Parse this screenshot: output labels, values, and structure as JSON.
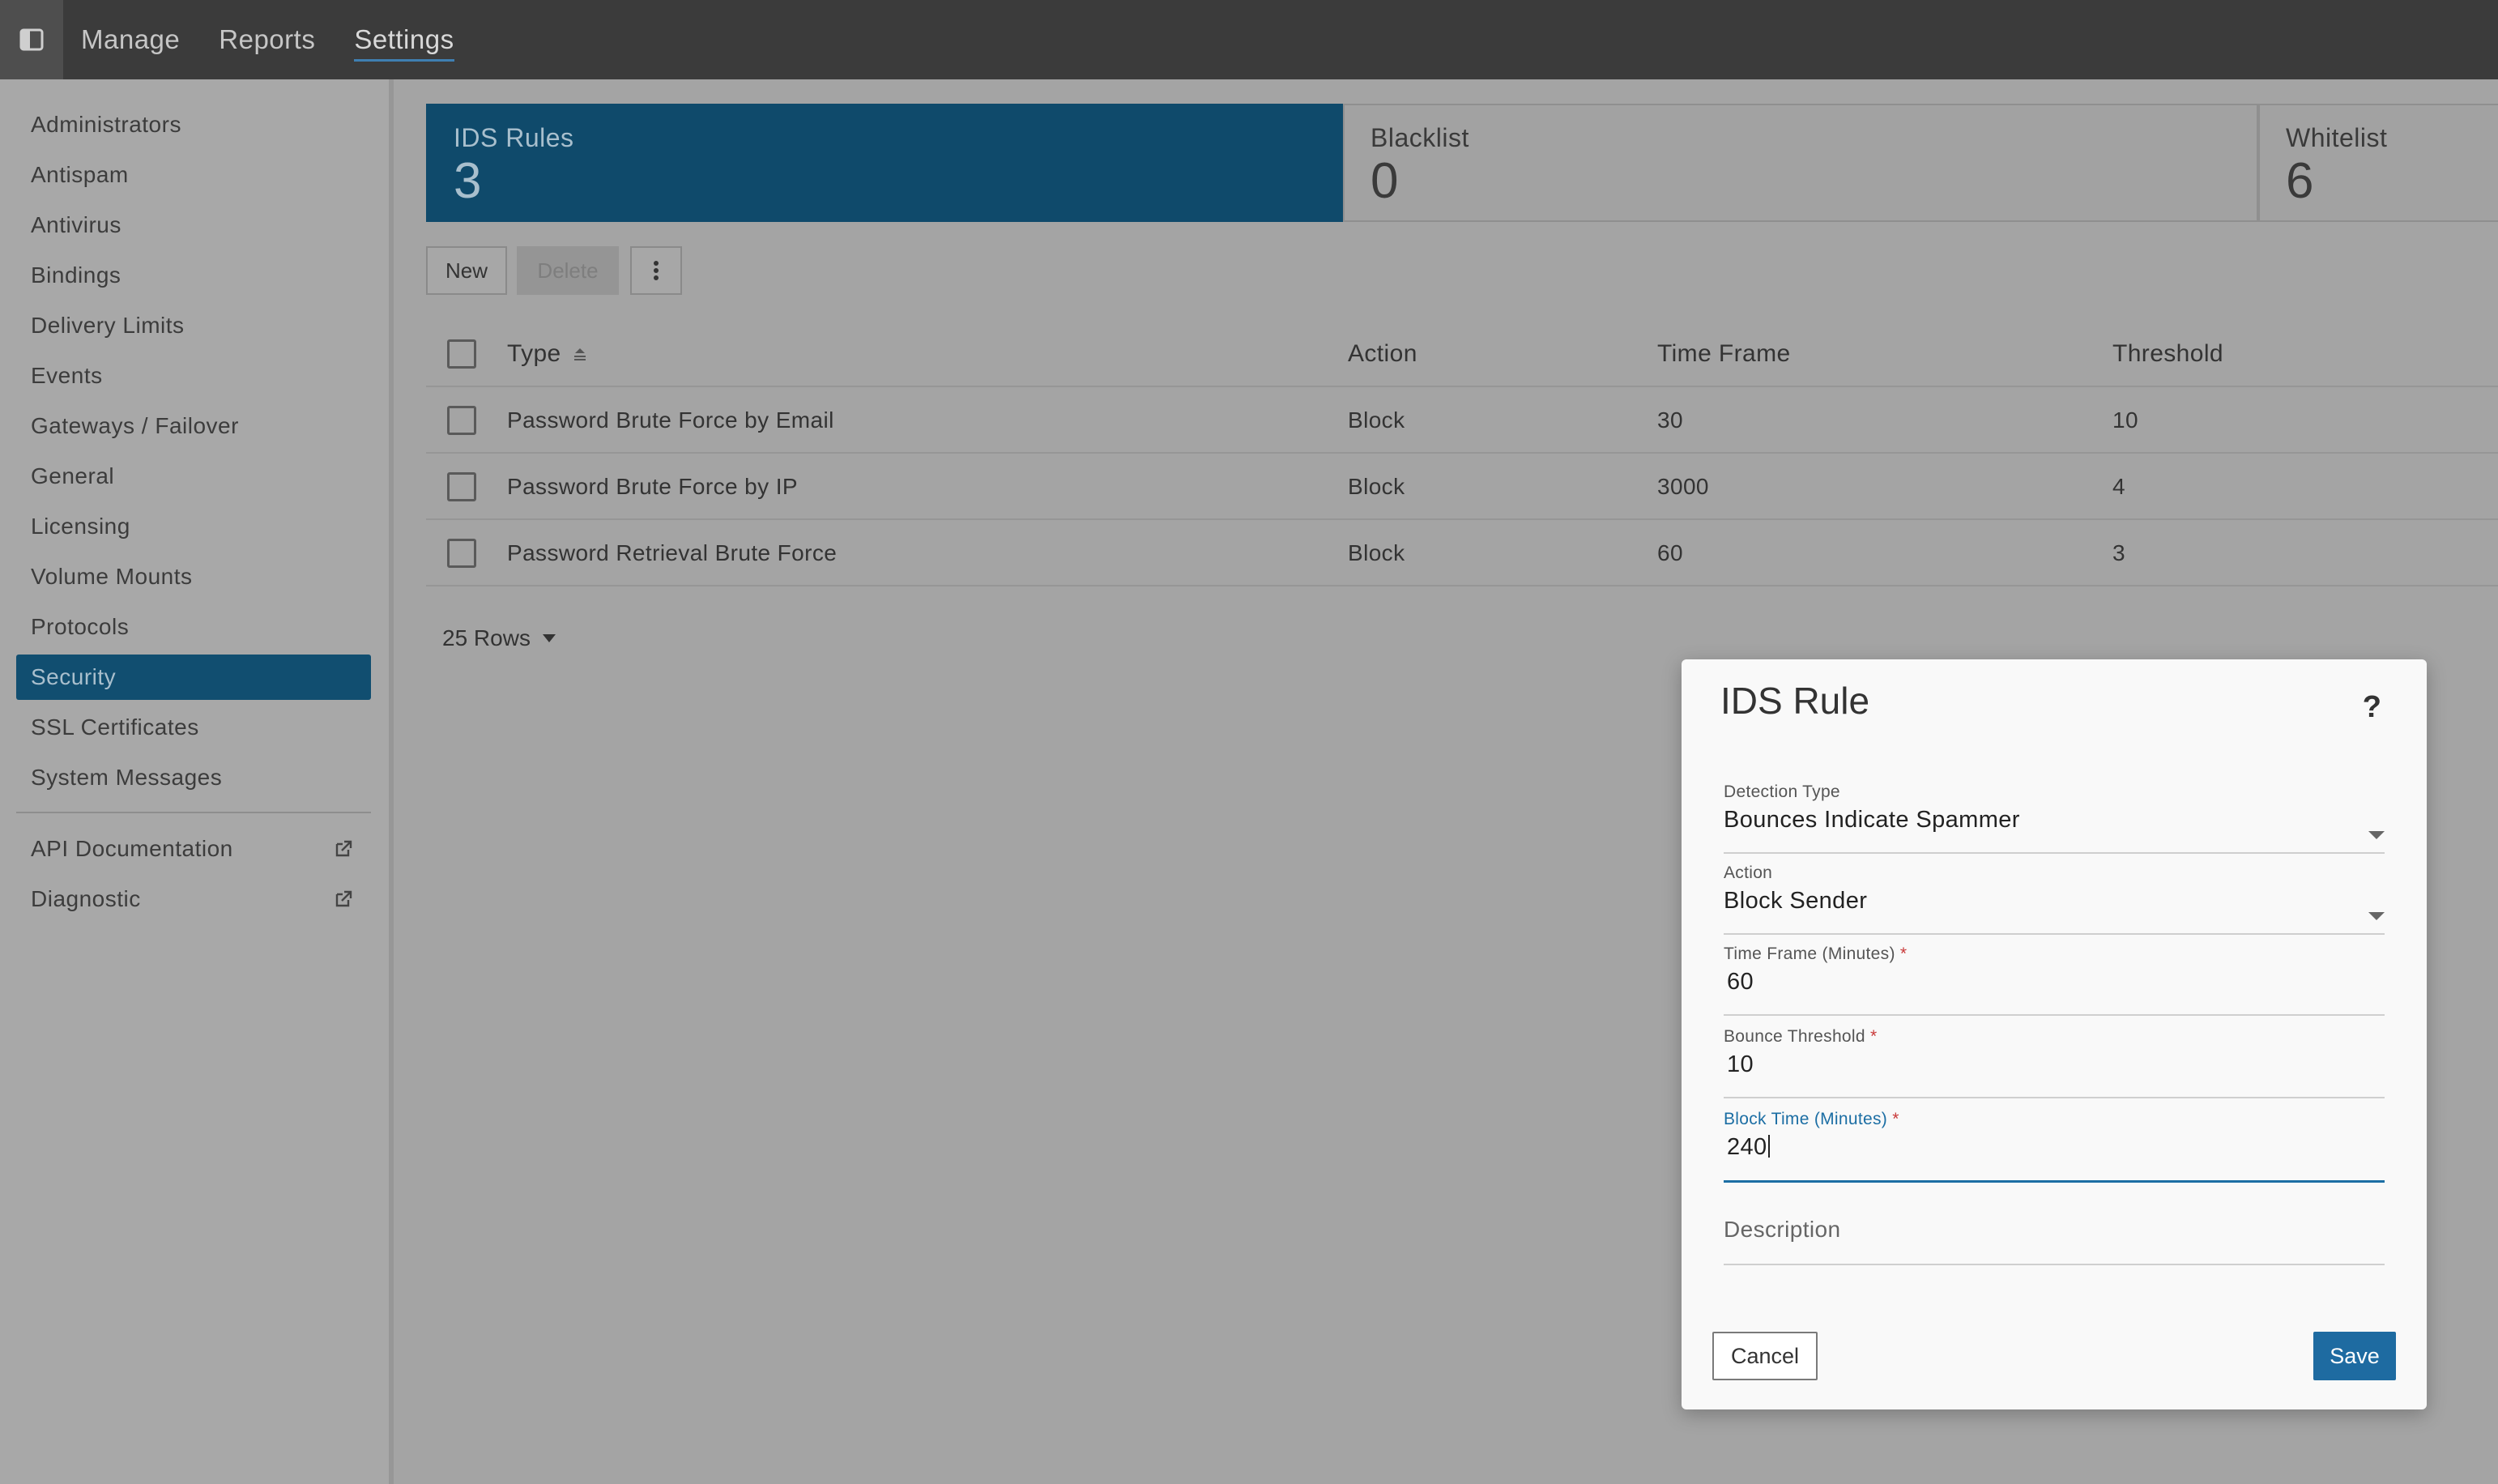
{
  "topbar": {
    "nav": [
      "Manage",
      "Reports",
      "Settings"
    ],
    "active": "Settings"
  },
  "sidebar": {
    "items": [
      "Administrators",
      "Antispam",
      "Antivirus",
      "Bindings",
      "Delivery Limits",
      "Events",
      "Gateways / Failover",
      "General",
      "Licensing",
      "Volume Mounts",
      "Protocols",
      "Security",
      "SSL Certificates",
      "System Messages"
    ],
    "active": "Security",
    "external": [
      "API Documentation",
      "Diagnostic"
    ]
  },
  "tiles": [
    {
      "label": "IDS Rules",
      "count": "3"
    },
    {
      "label": "Blacklist",
      "count": "0"
    },
    {
      "label": "Whitelist",
      "count": "6"
    }
  ],
  "toolbar": {
    "new_label": "New",
    "delete_label": "Delete"
  },
  "table": {
    "columns": [
      "Type",
      "Action",
      "Time Frame",
      "Threshold"
    ],
    "rows": [
      {
        "type": "Password Brute Force by Email",
        "action": "Block",
        "time_frame": "30",
        "threshold": "10"
      },
      {
        "type": "Password Brute Force by IP",
        "action": "Block",
        "time_frame": "3000",
        "threshold": "4"
      },
      {
        "type": "Password Retrieval Brute Force",
        "action": "Block",
        "time_frame": "60",
        "threshold": "3"
      }
    ],
    "rows_per_page": "25 Rows"
  },
  "dialog": {
    "title": "IDS Rule",
    "help": "?",
    "fields": {
      "detection_type": {
        "label": "Detection Type",
        "value": "Bounces Indicate Spammer"
      },
      "action": {
        "label": "Action",
        "value": "Block Sender"
      },
      "time_frame": {
        "label": "Time Frame (Minutes)",
        "value": "60"
      },
      "bounce_threshold": {
        "label": "Bounce Threshold",
        "value": "10"
      },
      "block_time": {
        "label": "Block Time (Minutes)",
        "value": "240"
      },
      "description": {
        "placeholder": "Description"
      }
    },
    "required_mark": "*",
    "cancel_label": "Cancel",
    "save_label": "Save"
  },
  "colors": {
    "accent": "#0f4a6b",
    "primary_button": "#1e6ba1",
    "topbar": "#3b3b3b"
  }
}
